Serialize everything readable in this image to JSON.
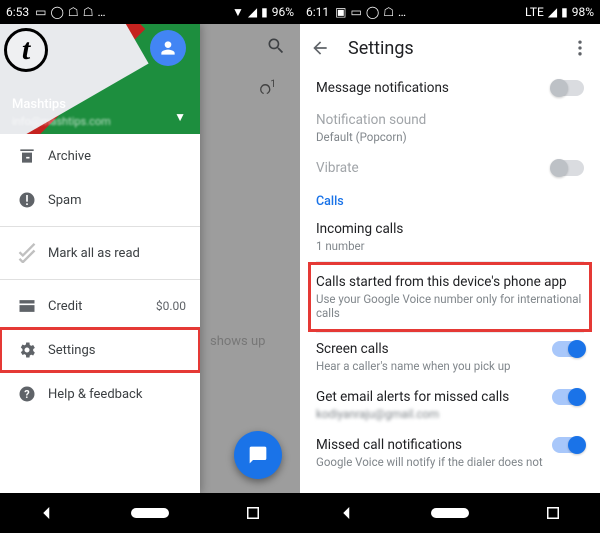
{
  "left": {
    "status": {
      "time": "6:53",
      "battery": "96%"
    },
    "drawer": {
      "username": "Mashtips",
      "email": "info@mashtips.com",
      "items": [
        {
          "icon": "archive",
          "label": "Archive"
        },
        {
          "icon": "spam",
          "label": "Spam"
        },
        {
          "icon": "markread",
          "label": "Mark all as read"
        }
      ],
      "items2": [
        {
          "icon": "credit",
          "label": "Credit",
          "value": "$0.00"
        },
        {
          "icon": "settings",
          "label": "Settings",
          "highlight": true
        },
        {
          "icon": "help",
          "label": "Help & feedback"
        }
      ]
    },
    "empty_text": "shows up",
    "vm_badge": "1"
  },
  "right": {
    "status": {
      "time": "6:11",
      "net": "LTE",
      "battery": "98%"
    },
    "title": "Settings",
    "rows": {
      "msg": {
        "t": "Message notifications",
        "on": false
      },
      "sound": {
        "t": "Notification sound",
        "s": "Default (Popcorn)"
      },
      "vibrate": {
        "t": "Vibrate",
        "on": false
      },
      "section": "Calls",
      "incoming": {
        "t": "Incoming calls",
        "s": "1 number"
      },
      "phoneapp": {
        "t": "Calls started from this device's phone app",
        "s": "Use your Google Voice number only for international calls",
        "highlight": true
      },
      "screen": {
        "t": "Screen calls",
        "s": "Hear a caller's name when you pick up",
        "on": true
      },
      "email": {
        "t": "Get email alerts for missed calls",
        "s": "kodiyanraju@gmail.com",
        "on": true
      },
      "missed": {
        "t": "Missed call notifications",
        "s": "Google Voice will notify if the dialer does not",
        "on": true
      }
    }
  }
}
